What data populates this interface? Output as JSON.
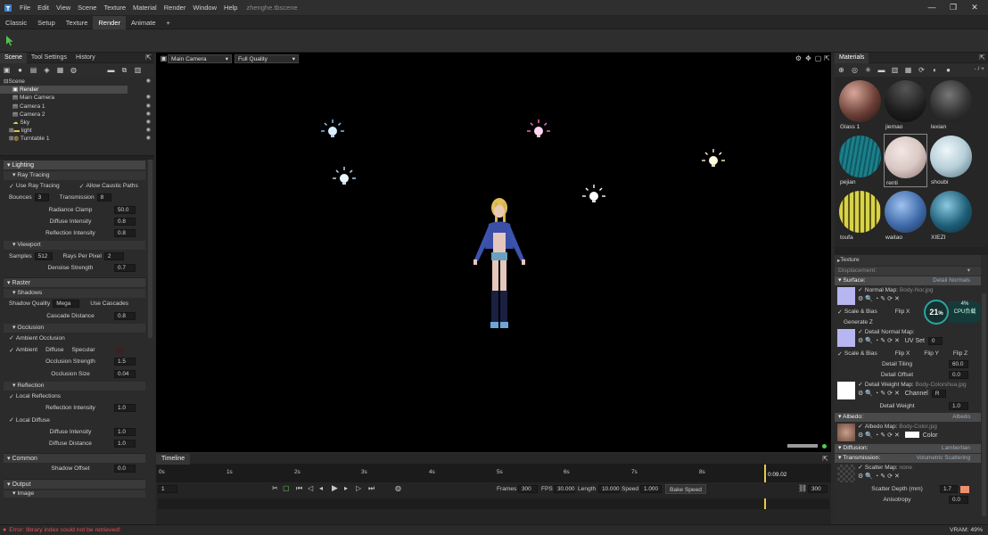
{
  "window": {
    "menus": [
      "File",
      "Edit",
      "View",
      "Scene",
      "Texture",
      "Material",
      "Render",
      "Window",
      "Help"
    ],
    "filename": "zhenghe.tbscene",
    "controls": {
      "minimize": "—",
      "restore": "❐",
      "close": "✕"
    }
  },
  "workspace_tabs": [
    "Classic",
    "Setup",
    "Texture",
    "Render",
    "Animate",
    "+"
  ],
  "active_workspace": "Render",
  "left_tabs": [
    "Scene",
    "Tool Settings",
    "History"
  ],
  "scene_tree": [
    "Scene",
    "Render",
    "Main Camera",
    "Camera 1",
    "Camera 2",
    "Sky",
    "light",
    "Turntable 1"
  ],
  "lighting": {
    "title": "Lighting",
    "ray_tracing": {
      "title": "Ray Tracing",
      "use_ray_tracing": "Use Ray Tracing",
      "allow_caustic": "Allow Caustic Paths",
      "bounces_label": "Bounces",
      "bounces": "3",
      "transmission_label": "Transmission",
      "transmission": "8",
      "radiance_clamp_label": "Radiance Clamp",
      "radiance_clamp": "50.0",
      "diffuse_intensity_label": "Diffuse Intensity",
      "diffuse_intensity": "0.8",
      "reflection_intensity_label": "Reflection Intensity",
      "reflection_intensity": "0.8"
    },
    "viewport": {
      "title": "Viewport",
      "samples_label": "Samples",
      "samples": "512",
      "rays_label": "Rays Per Pixel",
      "rays": "2",
      "denoise_label": "Denoise Strength",
      "denoise": "0.7"
    }
  },
  "raster": {
    "title": "Raster",
    "shadows": {
      "title": "Shadows",
      "quality_label": "Shadow Quality",
      "quality": "Mega",
      "use_cascades": "Use Cascades",
      "cascade_label": "Cascade Distance",
      "cascade": "0.8"
    },
    "occlusion": {
      "title": "Occlusion",
      "ambient_occlusion": "Ambient Occlusion",
      "ambient": "Ambient",
      "diffuse": "Diffuse",
      "specular": "Specular",
      "strength_label": "Occlusion Strength",
      "strength": "1.5",
      "size_label": "Occlusion Size",
      "size": "0.04"
    },
    "reflection": {
      "title": "Reflection",
      "local_reflections": "Local Reflections",
      "intensity_label": "Reflection Intensity",
      "intensity": "1.0",
      "local_diffuse": "Local Diffuse",
      "diffuse_intensity_label": "Diffuse Intensity",
      "diffuse_intensity": "1.0",
      "diffuse_distance_label": "Diffuse Distance",
      "diffuse_distance": "1.0"
    }
  },
  "common": {
    "title": "Common",
    "shadow_offset_label": "Shadow Offset",
    "shadow_offset": "0.0"
  },
  "output": {
    "title": "Output",
    "image": "Image"
  },
  "viewport_bar": {
    "camera": "Main Camera",
    "quality": "Full Quality"
  },
  "timeline": {
    "title": "Timeline",
    "ticks": [
      "0s",
      "1s",
      "2s",
      "3s",
      "4s",
      "5s",
      "6s",
      "7s",
      "8s"
    ],
    "current": "0:09.02",
    "frame": "1",
    "frames_label": "Frames",
    "frames": "300",
    "fps_label": "FPS",
    "fps": "30.000",
    "length_label": "Length",
    "length": "10.000",
    "speed_label": "Speed",
    "speed": "1.000",
    "bake_speed": "Bake Speed",
    "end_frame": "300"
  },
  "materials": {
    "title": "Materials",
    "counter": "- / +",
    "items": [
      {
        "name": "Glass 1",
        "color": "#6b3f36"
      },
      {
        "name": "jiemao",
        "color": "#2a2a2a"
      },
      {
        "name": "lexian",
        "color": "#3a3a3a"
      },
      {
        "name": "pejian",
        "color": "#1b7f8a"
      },
      {
        "name": "renti",
        "color": "#d9c8c4"
      },
      {
        "name": "shoubi",
        "color": "#b7cfd8"
      },
      {
        "name": "toufa",
        "color": "#d8d24a"
      },
      {
        "name": "waitao",
        "color": "#3f6aa8"
      },
      {
        "name": "XIEZI",
        "color": "#1f5f78"
      }
    ]
  },
  "material_props": {
    "texture": "Texture",
    "displacement": "Displacement:",
    "surface": "Surface:",
    "surface_value": "Detail Normals",
    "normal_map": "Normal Map:",
    "normal_file": "Body-Nor.jpg",
    "scale_bias": "Scale & Bias",
    "flip_x": "Flip X",
    "generate_z": "Generate Z",
    "detail_normal_map": "Detail Normal Map:",
    "uv_set_label": "UV Set",
    "uv_set": "0",
    "scale_bias2": "Scale & Bias",
    "flip_x2": "Flip X",
    "flip_y": "Flip Y",
    "flip_z": "Flip Z",
    "detail_tiling_label": "Detail Tiling",
    "detail_tiling": "60.0",
    "detail_offset_label": "Detail Offset",
    "detail_offset": "0.0",
    "detail_weight_map": "Detail Weight Map:",
    "detail_weight_file": "Body-Colorshua.jpg",
    "channel_label": "Channel",
    "channel": "R",
    "detail_weight_label": "Detail Weight",
    "detail_weight": "1.0",
    "albedo": "Albedo:",
    "albedo_value": "Albedo",
    "albedo_map": "Albedo Map:",
    "albedo_file": "Body-Color.jpg",
    "color_label": "Color",
    "diffusion": "Diffusion:",
    "diffusion_value": "Lambertian",
    "transmission": "Transmission:",
    "transmission_value": "Volumetric Scattering",
    "scatter_map": "Scatter Map:",
    "scatter_file": "none",
    "scatter_depth_label": "Scatter Depth (mm)",
    "scatter_depth": "1.7",
    "anisotropy_label": "Anisotropy",
    "anisotropy": "0.0"
  },
  "cpu_widget": {
    "percent": "21",
    "unit": "%",
    "small": "4%",
    "label": "CPU负载"
  },
  "status": {
    "error": "Error: library index could not be retrieved!",
    "vram": "VRAM: 49%"
  },
  "colors": {
    "accent_teal": "#2aa5a0",
    "error_red": "#e05050",
    "scatter_swatch": "#f08f70"
  }
}
